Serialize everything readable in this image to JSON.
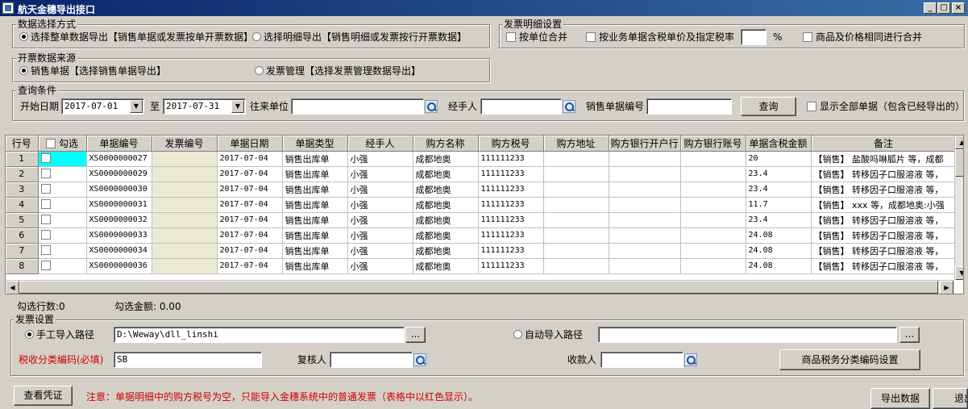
{
  "window": {
    "title": "航天金穗导出接口",
    "min": "_",
    "max": "□",
    "close": "×"
  },
  "export_mode": {
    "title": "数据选择方式",
    "option1": "选择整单数据导出【销售单据或发票按单开票数据】",
    "option2": "选择明细导出【销售明细或发票按行开票数据】",
    "selected": "option1"
  },
  "invoice_detail": {
    "title": "发票明细设置",
    "merge_by_unit": "按单位合并",
    "by_tax_rate": "按业务单据含税单价及指定税率",
    "tax_rate_value": "",
    "percent": "%",
    "merge_same": "商品及价格相同进行合并"
  },
  "data_source": {
    "title": "开票数据来源",
    "option1": "销售单据【选择销售单据导出】",
    "option2": "发票管理【选择发票管理数据导出】",
    "selected": "option1"
  },
  "query": {
    "title": "查询条件",
    "start_label": "开始日期",
    "start_date": "2017-07-01",
    "to_label": "至",
    "end_date": "2017-07-31",
    "partner_label": "往来单位",
    "partner_value": "",
    "handler_label": "经手人",
    "handler_value": "",
    "doc_no_label": "销售单据编号",
    "doc_no_value": "",
    "query_button": "查询",
    "show_all": "显示全部单据（包含已经导出的）"
  },
  "table": {
    "headers": [
      "行号",
      "勾选",
      "单据编号",
      "发票编号",
      "单据日期",
      "单据类型",
      "经手人",
      "购方名称",
      "购方税号",
      "购方地址",
      "购方银行开户行",
      "购方银行账号",
      "单据含税金额",
      "备注"
    ],
    "rows": [
      {
        "no": "1",
        "doc": "XS0000000027",
        "inv": "",
        "date": "2017-07-04",
        "type": "销售出库单",
        "handler": "小强",
        "buyer": "成都地奥",
        "tax": "111111233",
        "addr": "",
        "bank": "",
        "acct": "",
        "amount": "20",
        "memo": "【销售】 盐酸吗啉胍片 等，成都"
      },
      {
        "no": "2",
        "doc": "XS0000000029",
        "inv": "",
        "date": "2017-07-04",
        "type": "销售出库单",
        "handler": "小强",
        "buyer": "成都地奥",
        "tax": "111111233",
        "addr": "",
        "bank": "",
        "acct": "",
        "amount": "23.4",
        "memo": "【销售】 转移因子口服溶液 等，"
      },
      {
        "no": "3",
        "doc": "XS0000000030",
        "inv": "",
        "date": "2017-07-04",
        "type": "销售出库单",
        "handler": "小强",
        "buyer": "成都地奥",
        "tax": "111111233",
        "addr": "",
        "bank": "",
        "acct": "",
        "amount": "23.4",
        "memo": "【销售】 转移因子口服溶液 等，"
      },
      {
        "no": "4",
        "doc": "XS0000000031",
        "inv": "",
        "date": "2017-07-04",
        "type": "销售出库单",
        "handler": "小强",
        "buyer": "成都地奥",
        "tax": "111111233",
        "addr": "",
        "bank": "",
        "acct": "",
        "amount": "11.7",
        "memo": "【销售】 xxx 等，成都地奥:小强"
      },
      {
        "no": "5",
        "doc": "XS0000000032",
        "inv": "",
        "date": "2017-07-04",
        "type": "销售出库单",
        "handler": "小强",
        "buyer": "成都地奥",
        "tax": "111111233",
        "addr": "",
        "bank": "",
        "acct": "",
        "amount": "23.4",
        "memo": "【销售】 转移因子口服溶液 等，"
      },
      {
        "no": "6",
        "doc": "XS0000000033",
        "inv": "",
        "date": "2017-07-04",
        "type": "销售出库单",
        "handler": "小强",
        "buyer": "成都地奥",
        "tax": "111111233",
        "addr": "",
        "bank": "",
        "acct": "",
        "amount": "24.08",
        "memo": "【销售】 转移因子口服溶液 等，"
      },
      {
        "no": "7",
        "doc": "XS0000000034",
        "inv": "",
        "date": "2017-07-04",
        "type": "销售出库单",
        "handler": "小强",
        "buyer": "成都地奥",
        "tax": "111111233",
        "addr": "",
        "bank": "",
        "acct": "",
        "amount": "24.08",
        "memo": "【销售】 转移因子口服溶液 等，"
      },
      {
        "no": "8",
        "doc": "XS0000000036",
        "inv": "",
        "date": "2017-07-04",
        "type": "销售出库单",
        "handler": "小强",
        "buyer": "成都地奥",
        "tax": "111111233",
        "addr": "",
        "bank": "",
        "acct": "",
        "amount": "24.08",
        "memo": "【销售】 转移因子口服溶液 等，"
      }
    ]
  },
  "summary": {
    "count_label": "勾选行数:0",
    "amount_label": "勾选金额: 0.00"
  },
  "invoice_settings": {
    "title": "发票设置",
    "manual_label": "手工导入路径",
    "manual_path": "D:\\Weway\\dll_linshi",
    "auto_label": "自动导入路径",
    "auto_path": "",
    "browse": "...",
    "tax_code_label": "税收分类编码(必填)",
    "tax_code_value": "SB",
    "reviewer_label": "复核人",
    "reviewer_value": "",
    "payee_label": "收款人",
    "payee_value": "",
    "tax_code_button": "商品税务分类编码设置",
    "selected": "manual"
  },
  "footer": {
    "view_voucher": "查看凭证",
    "note": "注意：单据明细中的购方税号为空，只能导入金穗系统中的普通发票（表格中以红色显示）。",
    "export": "导出数据",
    "exit": "退出"
  }
}
